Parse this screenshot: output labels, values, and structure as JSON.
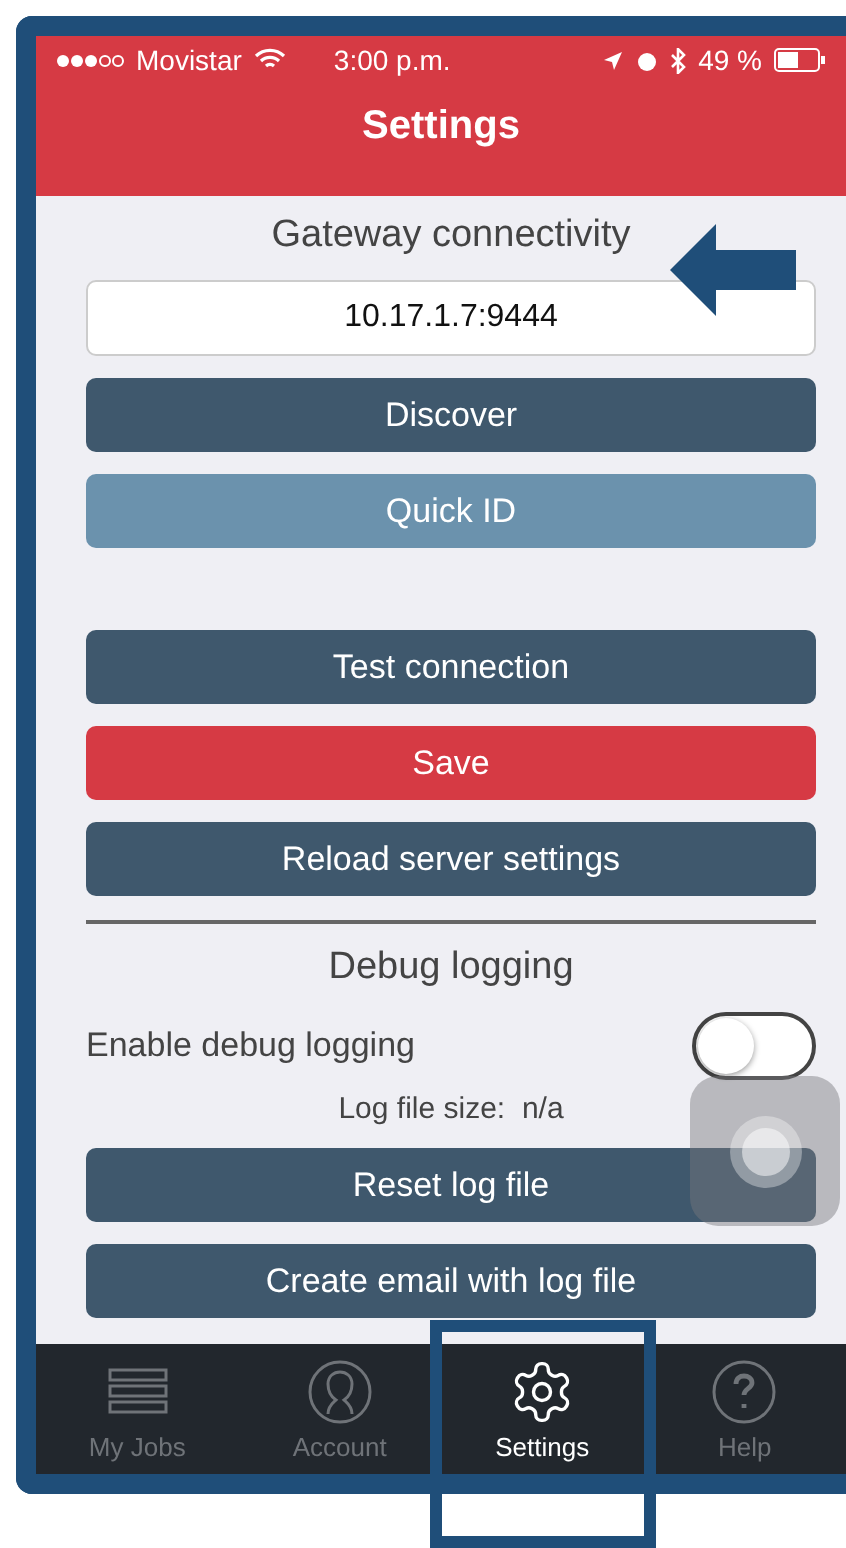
{
  "status_bar": {
    "carrier": "Movistar",
    "time": "3:00 p.m.",
    "battery": "49 %"
  },
  "title": "Settings",
  "gateway": {
    "heading": "Gateway connectivity",
    "address": "10.17.1.7:9444"
  },
  "buttons_top": [
    {
      "label": "Discover",
      "kind": "primary"
    },
    {
      "label": "Quick ID",
      "kind": "secondary"
    }
  ],
  "buttons_server": [
    {
      "label": "Test connection",
      "kind": "primary"
    },
    {
      "label": "Save",
      "kind": "danger"
    },
    {
      "label": "Reload server settings",
      "kind": "primary"
    }
  ],
  "debug": {
    "heading": "Debug logging",
    "toggle_label": "Enable debug logging",
    "on": false,
    "log_size_label": "Log file size:",
    "log_size": "n/a"
  },
  "buttons_log": [
    {
      "label": "Reset log file",
      "kind": "primary"
    },
    {
      "label": "Create email with log file",
      "kind": "primary"
    }
  ],
  "tabs": [
    {
      "label": "My Jobs",
      "kind": "list",
      "selected": false
    },
    {
      "label": "Account",
      "kind": "person",
      "selected": false
    },
    {
      "label": "Settings",
      "kind": "gear",
      "selected": true
    },
    {
      "label": "Help",
      "kind": "help",
      "selected": false
    }
  ]
}
